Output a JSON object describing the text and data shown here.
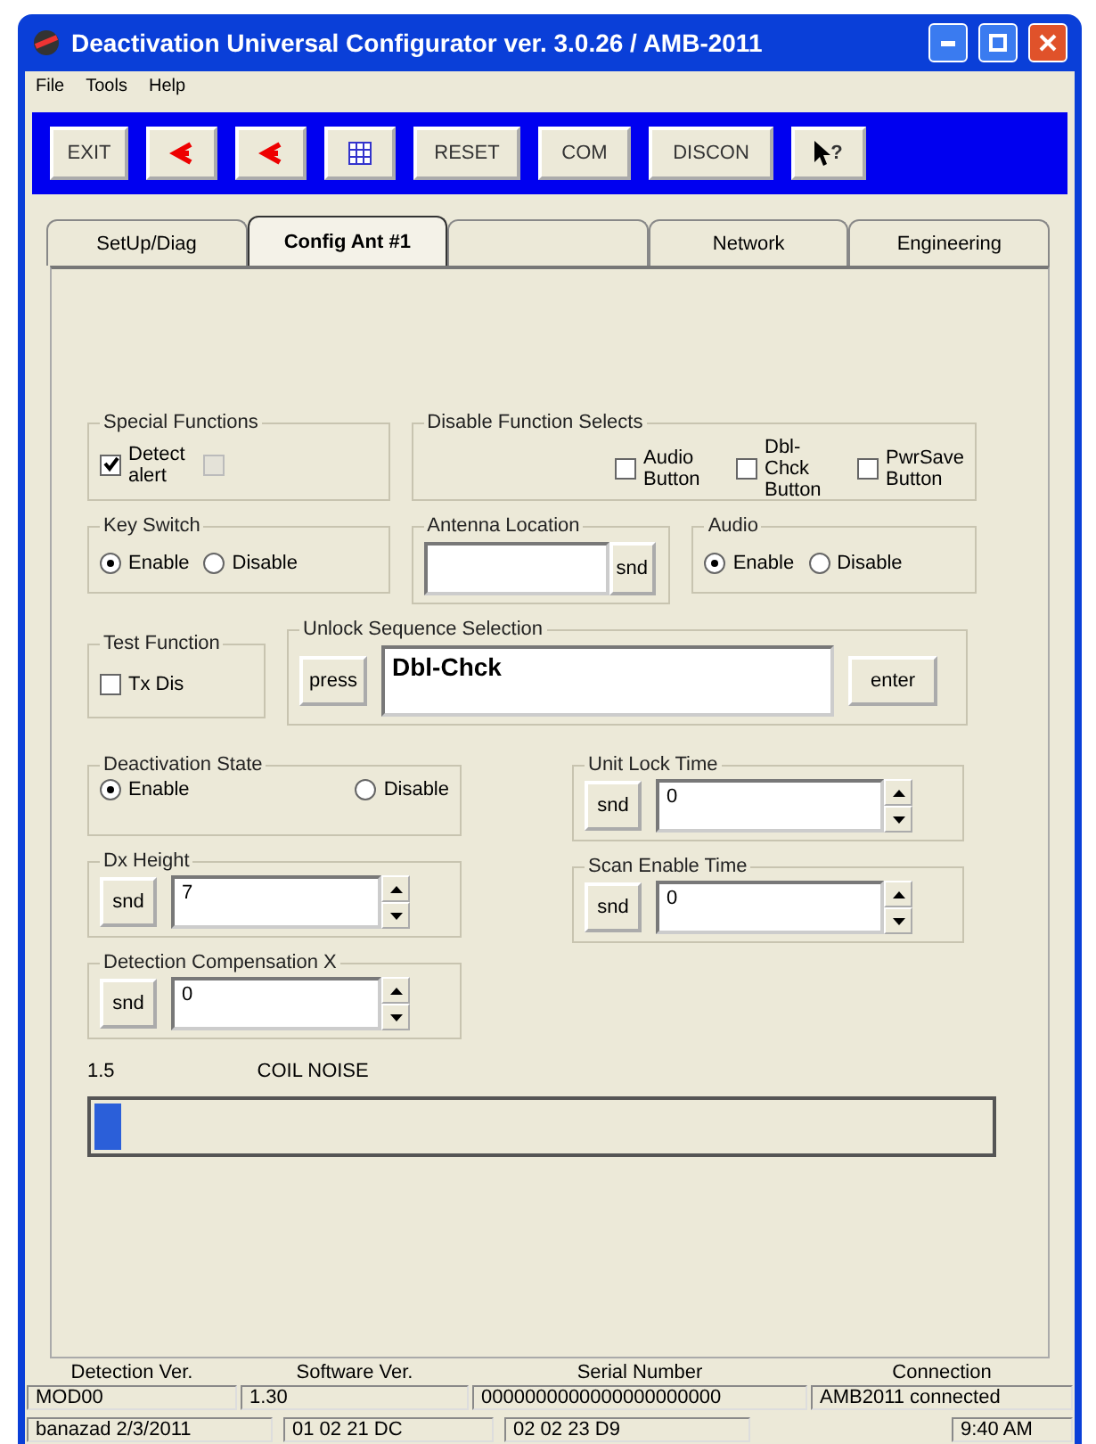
{
  "window": {
    "title": "Deactivation Universal Configurator ver. 3.0.26 / AMB-2011"
  },
  "menu": [
    "File",
    "Tools",
    "Help"
  ],
  "toolbar": [
    {
      "kind": "text",
      "label": "EXIT"
    },
    {
      "kind": "arrow"
    },
    {
      "kind": "arrow"
    },
    {
      "kind": "grid"
    },
    {
      "kind": "text",
      "label": "RESET"
    },
    {
      "kind": "text",
      "label": "COM"
    },
    {
      "kind": "text",
      "label": "DISCON"
    },
    {
      "kind": "help",
      "label": "?"
    }
  ],
  "tabs": [
    {
      "label": "SetUp/Diag",
      "selected": false
    },
    {
      "label": "Config Ant #1",
      "selected": true
    },
    {
      "selected": false
    },
    {
      "label": "Network",
      "selected": false
    },
    {
      "label": "Engineering",
      "selected": false
    }
  ],
  "special_functions": {
    "title": "Special Functions",
    "items": [
      {
        "label": "Detect alert",
        "checked": true,
        "disabled": false
      },
      {
        "checked": false,
        "disabled": true
      }
    ]
  },
  "disable_function_selects": {
    "title": "Disable Function Selects",
    "items": [
      {
        "label": "Audio Button",
        "checked": false
      },
      {
        "label": "Dbl-Chck Button",
        "checked": false
      },
      {
        "label": "PwrSave Button",
        "checked": false
      }
    ]
  },
  "key_switch": {
    "title": "Key Switch",
    "options": [
      {
        "label": "Enable",
        "selected": true
      },
      {
        "label": "Disable",
        "selected": false
      }
    ]
  },
  "antenna_location": {
    "title": "Antenna Location",
    "button": "snd"
  },
  "audio": {
    "title": "Audio",
    "options": [
      {
        "label": "Enable",
        "selected": true
      },
      {
        "label": "Disable",
        "selected": false
      }
    ]
  },
  "test_function": {
    "title": "Test Function",
    "items": [
      {
        "label": "Tx Dis",
        "checked": false
      }
    ]
  },
  "unlock_sequence": {
    "title": "Unlock Sequence Selection",
    "press": "press",
    "value": "Dbl-Chck",
    "enter": "enter"
  },
  "deactivation_state": {
    "title": "Deactivation State",
    "options": [
      {
        "label": "Enable",
        "selected": true
      },
      {
        "label": "Disable",
        "selected": false
      }
    ]
  },
  "unit_lock_time": {
    "title": "Unit Lock Time",
    "button": "snd",
    "value": "0"
  },
  "dx_height": {
    "title": "Dx Height",
    "button": "snd",
    "value": "7"
  },
  "scan_enable_time": {
    "title": "Scan Enable Time",
    "button": "snd",
    "value": "0"
  },
  "detection_compensation": {
    "title": "Detection Compensation X",
    "button": "snd",
    "value": "0"
  },
  "coil_noise": {
    "reading": "1.5",
    "label": "COIL NOISE",
    "level": 0.03
  },
  "status_bar": {
    "headings": [
      "Detection Ver.",
      "Software Ver.",
      "Serial Number",
      "Connection"
    ],
    "values": [
      "MOD00",
      "1.30",
      "0000000000000000000000",
      "AMB2011 connected"
    ],
    "footer": [
      "banazad 2/3/2011",
      "01 02 21 DC",
      "02 02 23 D9",
      "9:40 AM"
    ]
  }
}
